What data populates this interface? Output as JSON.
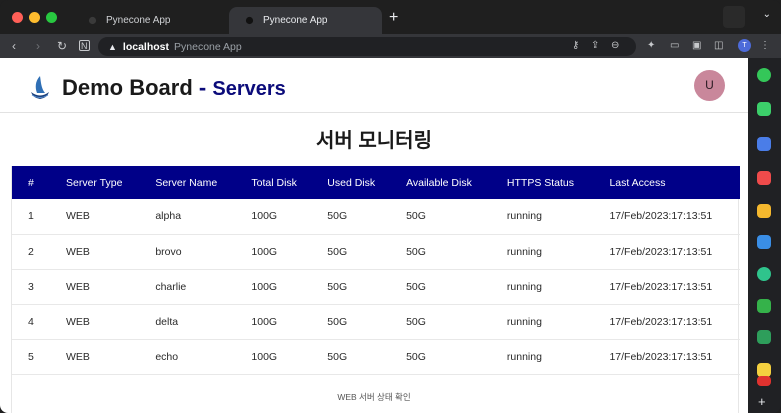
{
  "browser": {
    "tabs": [
      {
        "label": "Pynecone App",
        "active": false
      },
      {
        "label": "Pynecone App",
        "active": true
      }
    ],
    "new_tab": "+",
    "tabbar_menu": "⌄",
    "address": {
      "host": "localhost",
      "page_title": "Pynecone App"
    },
    "profile_initial": "T"
  },
  "app": {
    "brand": "Demo Board",
    "brand_sep": " - ",
    "brand_sub": "Servers",
    "avatar_initial": "U",
    "heading": "서버 모니터링",
    "table": {
      "headers": [
        "#",
        "Server Type",
        "Server Name",
        "Total Disk",
        "Used Disk",
        "Available Disk",
        "HTTPS Status",
        "Last Access"
      ],
      "rows": [
        [
          "1",
          "WEB",
          "alpha",
          "100G",
          "50G",
          "50G",
          "running",
          "17/Feb/2023:17:13:51"
        ],
        [
          "2",
          "WEB",
          "brovo",
          "100G",
          "50G",
          "50G",
          "running",
          "17/Feb/2023:17:13:51"
        ],
        [
          "3",
          "WEB",
          "charlie",
          "100G",
          "50G",
          "50G",
          "running",
          "17/Feb/2023:17:13:51"
        ],
        [
          "4",
          "WEB",
          "delta",
          "100G",
          "50G",
          "50G",
          "running",
          "17/Feb/2023:17:13:51"
        ],
        [
          "5",
          "WEB",
          "echo",
          "100G",
          "50G",
          "50G",
          "running",
          "17/Feb/2023:17:13:51"
        ]
      ],
      "caption": "WEB 서버 상태 확인"
    }
  },
  "colors": {
    "header_bg": "#000088",
    "brand_accent": "#0b0b7a",
    "avatar_bg": "#c9879b"
  },
  "sidebar_extensions": [
    "green-circle",
    "green-bell",
    "blue-box",
    "red-pocket",
    "yellow-star",
    "blue-cloud",
    "green-play",
    "green-chat",
    "green-calc",
    "yellow-note",
    "red-badge"
  ],
  "sidebar_plus": "+"
}
